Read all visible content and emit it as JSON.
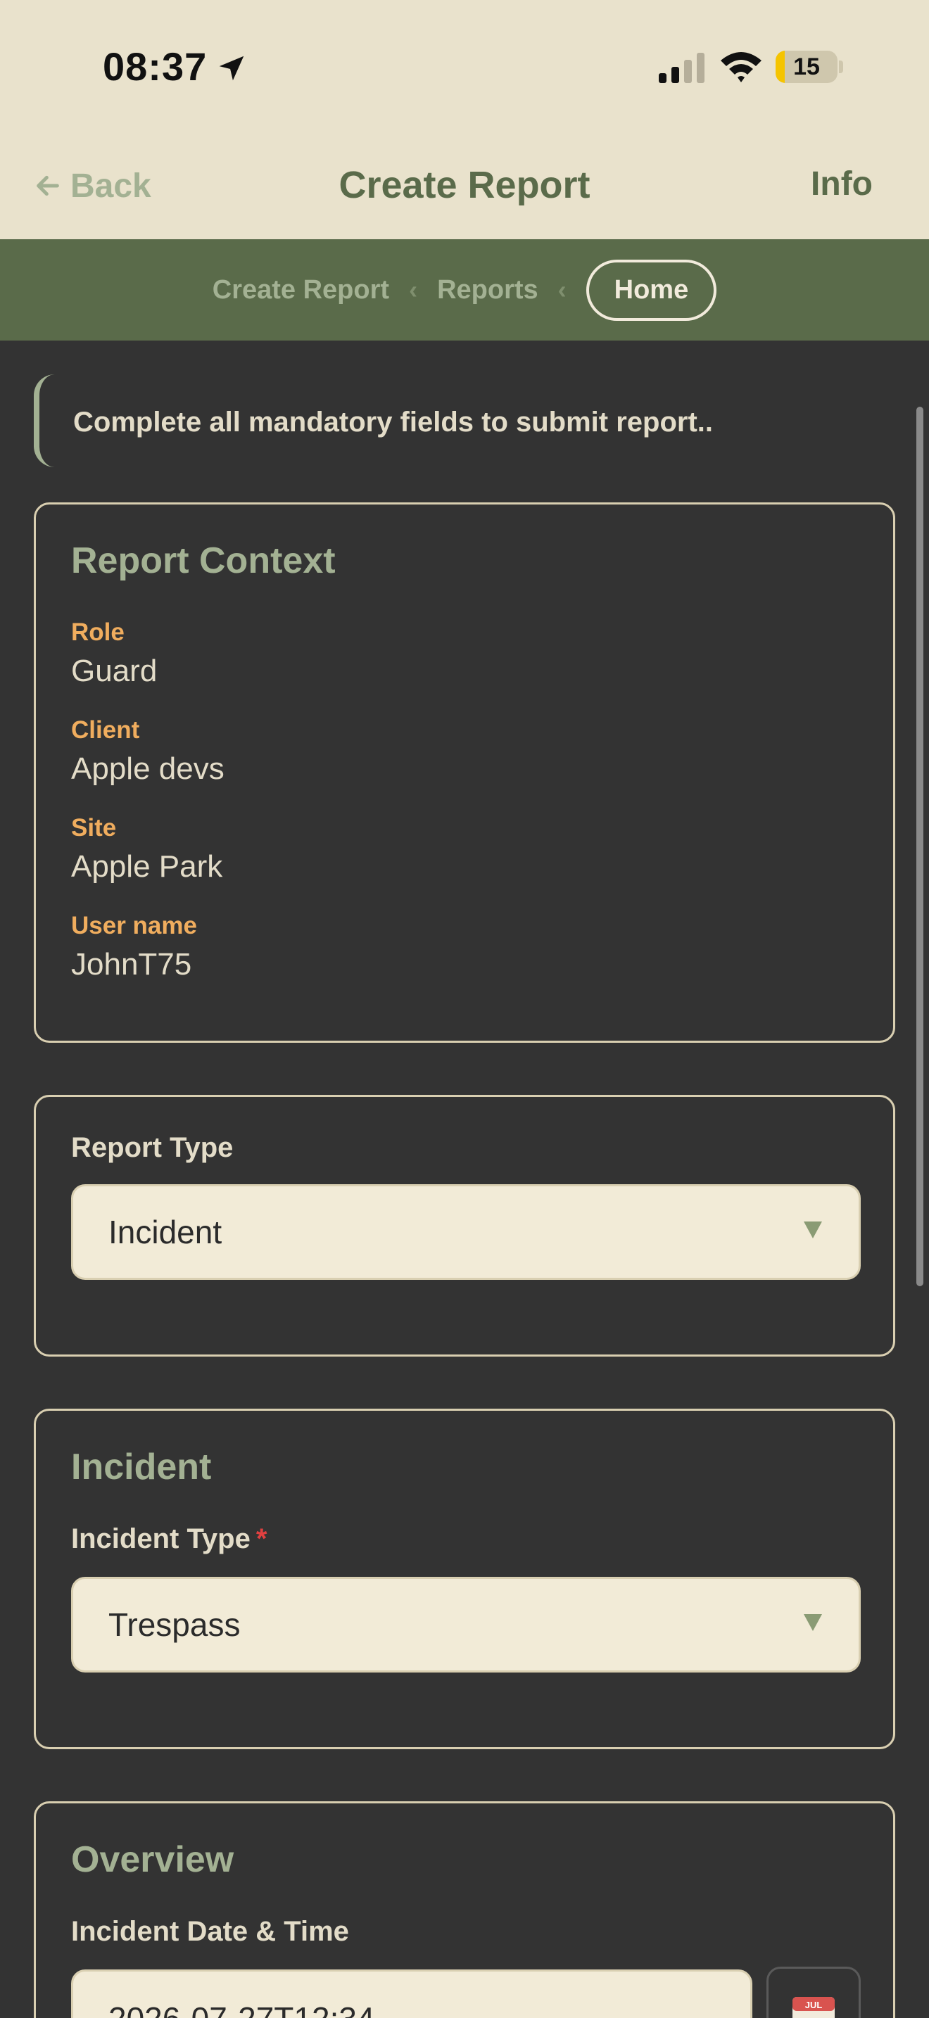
{
  "status_bar": {
    "time": "08:37",
    "battery": "15",
    "battery_level": 0.15
  },
  "nav": {
    "back_label": "Back",
    "title": "Create Report",
    "info_label": "Info"
  },
  "breadcrumb": {
    "items": [
      "Create Report",
      "Reports",
      "Home"
    ],
    "separator": "‹"
  },
  "notice": "Complete all mandatory fields to submit report..",
  "report_context": {
    "title": "Report Context",
    "fields": [
      {
        "label": "Role",
        "value": "Guard"
      },
      {
        "label": "Client",
        "value": "Apple devs"
      },
      {
        "label": "Site",
        "value": "Apple Park"
      },
      {
        "label": "User name",
        "value": "JohnT75"
      }
    ]
  },
  "report_type": {
    "label": "Report Type",
    "value": "Incident"
  },
  "incident": {
    "title": "Incident",
    "type_label": "Incident Type",
    "required_mark": "*",
    "type_value": "Trespass"
  },
  "overview": {
    "title": "Overview",
    "datetime_label": "Incident Date & Time",
    "datetime_value": "2026-07-27T12:34",
    "calendar_month": "JUL"
  },
  "colors": {
    "header_bg": "#e9e2cc",
    "breadcrumb_bg": "#5a6b4a",
    "page_bg": "#333333",
    "accent_green": "#a3b193",
    "label_orange": "#f0ad5e",
    "required_red": "#e04040",
    "input_bg": "#f2ebd7"
  }
}
